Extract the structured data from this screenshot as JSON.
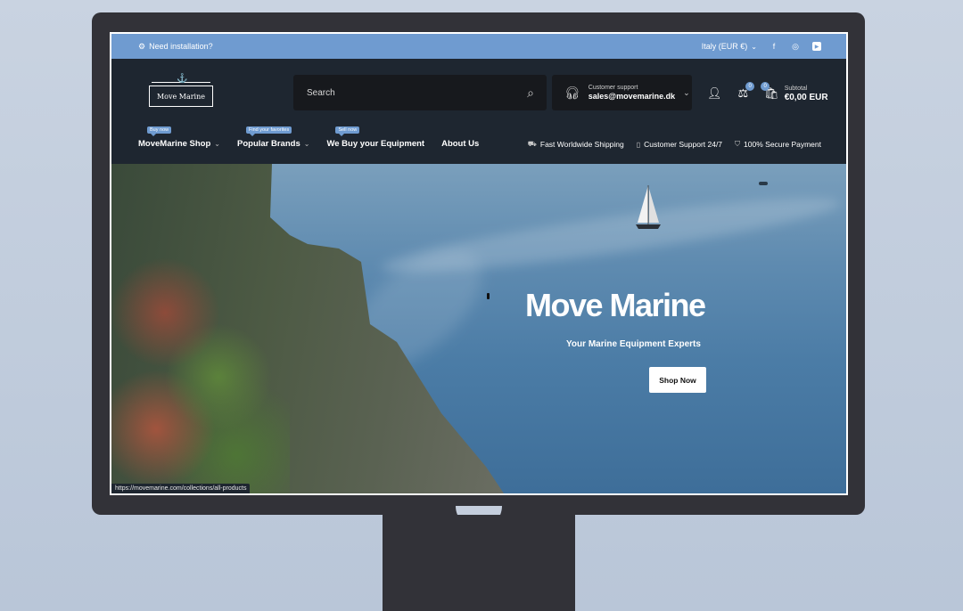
{
  "topbar": {
    "installation": "Need installation?",
    "locale": "Italy (EUR €)",
    "social": [
      "facebook-icon",
      "instagram-icon",
      "youtube-icon"
    ]
  },
  "header": {
    "logo_text": "Move Marine",
    "search_placeholder": "Search",
    "support_label": "Customer support",
    "support_email": "sales@movemarine.dk",
    "compare_count": "0",
    "cart_count": "0",
    "subtotal_label": "Subtotal",
    "subtotal_value": "€0,00 EUR"
  },
  "nav": {
    "items": [
      {
        "label": "MoveMarine Shop",
        "tag": "Buy now"
      },
      {
        "label": "Popular Brands",
        "tag": "Find your favorites"
      },
      {
        "label": "We Buy your Equipment",
        "tag": "Sell now"
      },
      {
        "label": "About Us",
        "tag": ""
      }
    ],
    "usps": [
      "Fast Worldwide Shipping",
      "Customer Support 24/7",
      "100% Secure Payment"
    ]
  },
  "hero": {
    "title": "Move Marine",
    "subtitle": "Your Marine Equipment Experts",
    "cta": "Shop Now"
  },
  "status_url": "https://movemarine.com/collections/all-products",
  "colors": {
    "accent": "#6f9bd0",
    "header_bg": "#1e2630",
    "field_bg": "#17191d",
    "monitor": "#323238"
  }
}
